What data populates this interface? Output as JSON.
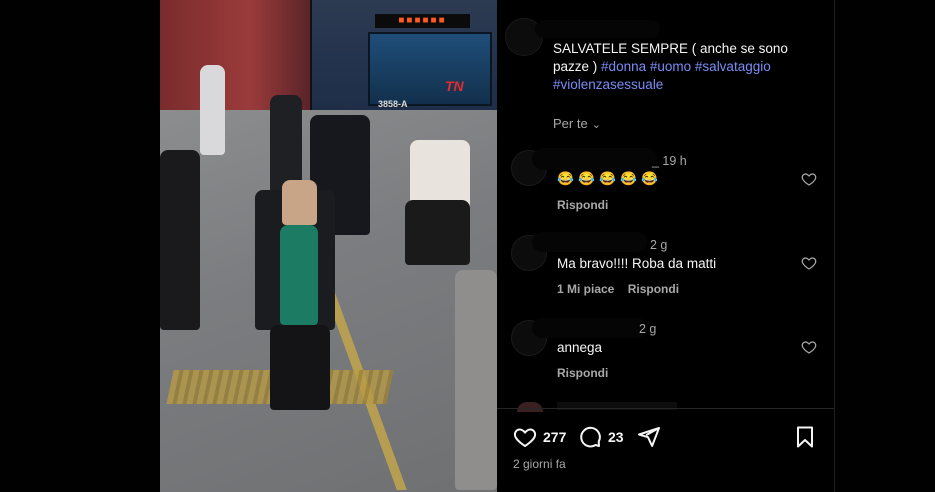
{
  "post": {
    "video_overlay": {
      "train_code": "3858-A",
      "broadcaster_logo": "TN"
    },
    "caption_text": "SALVATELE SEMPRE ( anche se sono pazze )",
    "hashtags": [
      "#donna",
      "#uomo",
      "#salvataggio",
      "#violenzasessuale"
    ],
    "for_you_label": "Per te",
    "likes_count": "277",
    "comments_count": "23",
    "date_label": "2 giorni fa"
  },
  "comments": [
    {
      "time": "_ 19 h",
      "emoji_count": 5,
      "emoji": "😂",
      "reply_label": "Rispondi"
    },
    {
      "time": "2 g",
      "text": "Ma bravo!!!! Roba da matti",
      "likes_label": "1 Mi piace",
      "reply_label": "Rispondi"
    },
    {
      "time": "2 g",
      "text": "annega",
      "reply_label": "Rispondi"
    }
  ],
  "icons": {
    "like": "heart-icon",
    "comment": "comment-bubble-icon",
    "share": "send-icon",
    "save": "bookmark-icon",
    "expand": "chevron-down-icon"
  },
  "colors": {
    "hashtag": "#7a8cf5",
    "secondary_text": "#a8a8a8",
    "background": "#000000"
  }
}
